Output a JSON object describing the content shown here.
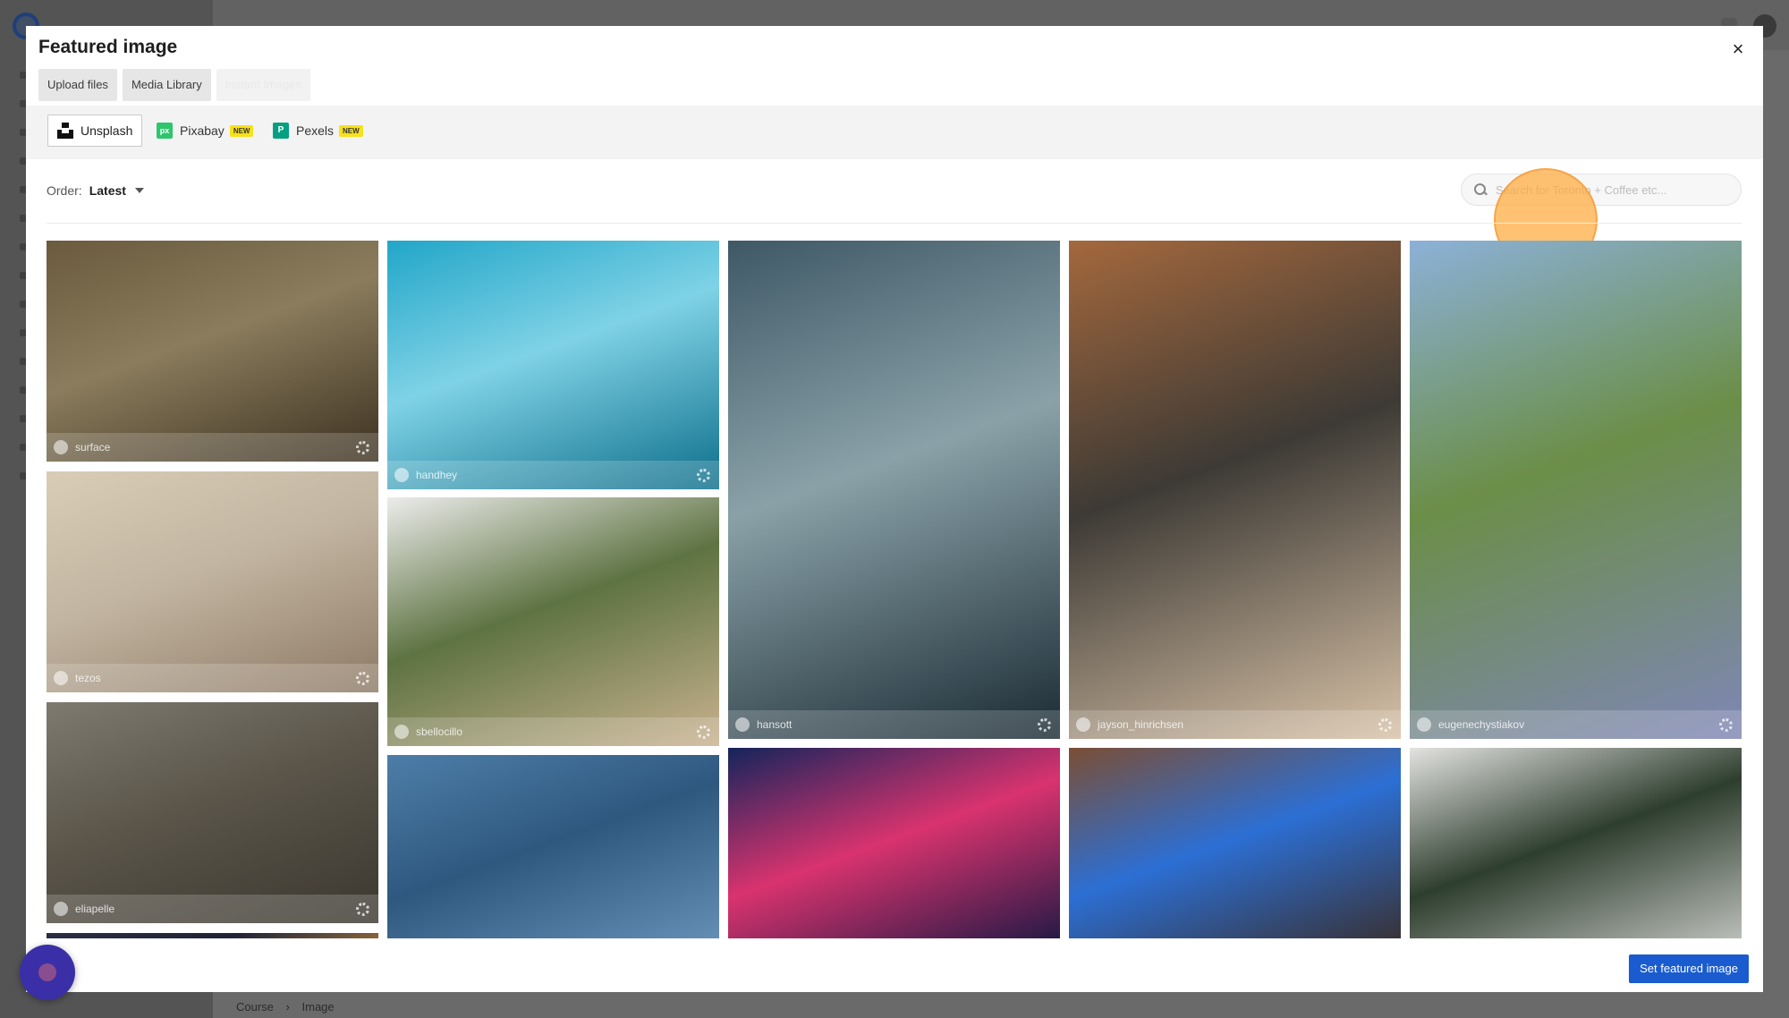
{
  "background": {
    "breadcrumb": [
      "Course",
      "Image"
    ]
  },
  "modal": {
    "title": "Featured image",
    "close_symbol": "×",
    "tabs": [
      {
        "label": "Upload files"
      },
      {
        "label": "Media Library"
      },
      {
        "label": "Instant Images"
      }
    ],
    "providers": [
      {
        "label": "Unsplash",
        "icon": "unsplash-icon",
        "selected": true,
        "new": false
      },
      {
        "label": "Pixabay",
        "icon": "pixabay-icon",
        "selected": false,
        "new": true,
        "new_label": "NEW"
      },
      {
        "label": "Pexels",
        "icon": "pexels-icon",
        "selected": false,
        "new": true,
        "new_label": "NEW"
      }
    ],
    "order": {
      "label": "Order:",
      "value": "Latest"
    },
    "search": {
      "placeholder": "Search for Toronto + Coffee etc...",
      "value": ""
    },
    "set_button_label": "Set featured image"
  },
  "photos": [
    {
      "user": "surface",
      "colors": [
        "#6b5a3e",
        "#3d3222",
        "#8a7c5c"
      ]
    },
    {
      "user": "tezos",
      "colors": [
        "#d9cdb7",
        "#8e7a66",
        "#c2b5a1"
      ]
    },
    {
      "user": "eliapelle",
      "colors": [
        "#7e7a6f",
        "#3b3830",
        "#5b554a"
      ]
    },
    {
      "user": "",
      "colors": [
        "#2a2f44",
        "#c28a3e",
        "#1e2336"
      ]
    },
    {
      "user": "handhey",
      "colors": [
        "#22a6c8",
        "#0d6e8a",
        "#7fd2e6"
      ]
    },
    {
      "user": "sbellocillo",
      "colors": [
        "#ececeb",
        "#c9b28f",
        "#5e7342"
      ]
    },
    {
      "user": "",
      "colors": [
        "#4d7ea8",
        "#6c95bc",
        "#2f587f"
      ]
    },
    {
      "user": "hansott",
      "colors": [
        "#3e5866",
        "#1a2a33",
        "#8aa1a8"
      ]
    },
    {
      "user": "",
      "colors": [
        "#15245c",
        "#0c1640",
        "#d9336e"
      ]
    },
    {
      "user": "jayson_hinrichsen",
      "colors": [
        "#a4683d",
        "#d8c2a7",
        "#3d3a35"
      ]
    },
    {
      "user": "",
      "colors": [
        "#7b4e35",
        "#3a2a22",
        "#2c6fd4"
      ]
    },
    {
      "user": "eugenechystiakov",
      "colors": [
        "#8cb1d8",
        "#7f86b6",
        "#6b8e48"
      ]
    },
    {
      "user": "",
      "colors": [
        "#e3e3e1",
        "#cfd0cd",
        "#2e3e2e"
      ]
    }
  ]
}
